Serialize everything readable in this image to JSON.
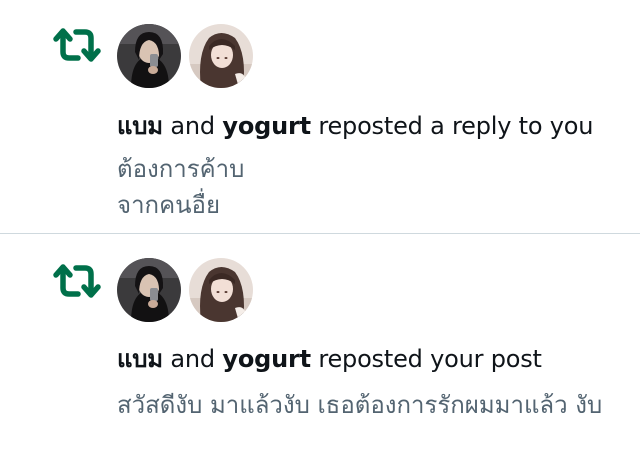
{
  "colors": {
    "repost_green": "#00704a",
    "text_primary": "#0f1419",
    "text_secondary": "#536471",
    "divider": "#cfd9de"
  },
  "notifications": [
    {
      "icon": "repost-icon",
      "users": [
        "แบม",
        "yogurt"
      ],
      "connector": "and",
      "action": "reposted a reply to you",
      "snippet": "ต้องการค้าบ\nจากคนอื่ย"
    },
    {
      "icon": "repost-icon",
      "users": [
        "แบม",
        "yogurt"
      ],
      "connector": "and",
      "action": "reposted your post",
      "snippet": "สวัสดีงับ มาแล้วงับ เธอต้องการรักผมมาแล้ว งับ"
    }
  ]
}
